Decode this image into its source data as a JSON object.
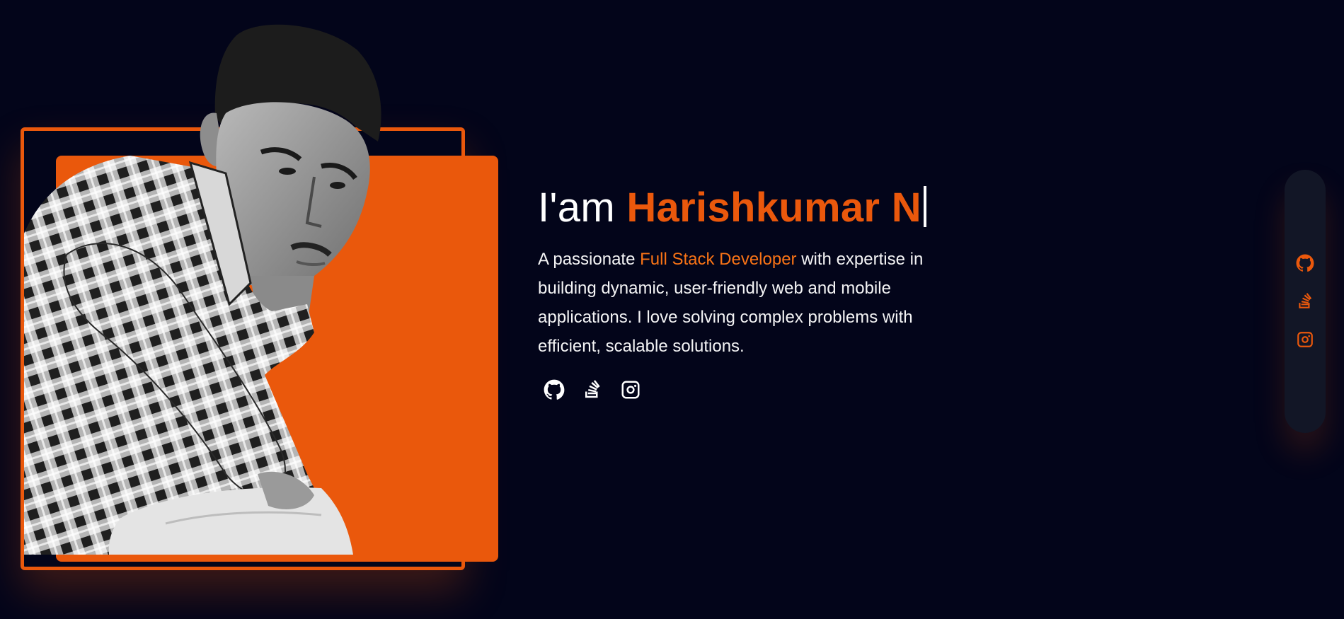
{
  "hero": {
    "headline_prefix": "I'am ",
    "name": "Harishkumar N",
    "bio_prefix": "A passionate ",
    "bio_highlight": "Full Stack Developer",
    "bio_suffix": " with expertise in building dynamic, user-friendly web and mobile applications. I love solving complex problems with efficient, scalable solutions.",
    "accent_color": "#ea580c"
  },
  "social_links": [
    {
      "icon": "github-icon",
      "label": "GitHub"
    },
    {
      "icon": "stackoverflow-icon",
      "label": "Stack Overflow"
    },
    {
      "icon": "instagram-icon",
      "label": "Instagram"
    }
  ],
  "side_dock": {
    "icons": [
      "github-icon",
      "stackoverflow-icon",
      "instagram-icon"
    ]
  }
}
